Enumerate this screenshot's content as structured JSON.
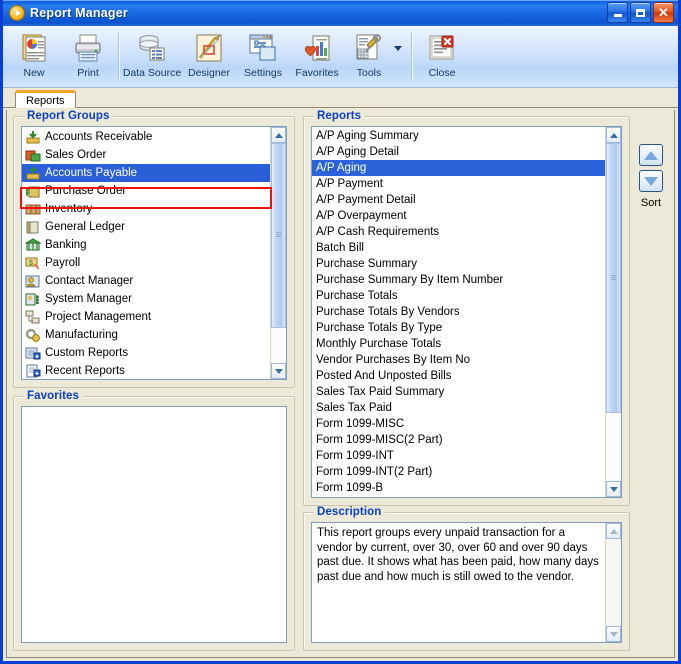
{
  "window": {
    "title": "Report Manager",
    "title_icon": "play-circle-icon",
    "minimize_label": "Minimize",
    "maximize_label": "Maximize",
    "close_label": "Close",
    "accent_titlebar": "#1c6fe8",
    "accent_group_title": "#0a3fbd",
    "selection_color": "#2a5fd8",
    "annotation_color": "#f01010",
    "background": "#ece9d8"
  },
  "toolbar": {
    "items": [
      {
        "label": "New",
        "icon": "new-report-icon"
      },
      {
        "label": "Print",
        "icon": "printer-icon"
      },
      {
        "label": "Data Source",
        "icon": "database-icon"
      },
      {
        "label": "Designer",
        "icon": "designer-pencil-icon"
      },
      {
        "label": "Settings",
        "icon": "settings-window-icon"
      },
      {
        "label": "Favorites",
        "icon": "favorites-heart-icon"
      },
      {
        "label": "Tools",
        "icon": "tools-wrench-icon"
      },
      {
        "label": "Close",
        "icon": "close-document-icon"
      }
    ]
  },
  "tabs": [
    {
      "label": "Reports",
      "active": true
    }
  ],
  "report_groups": {
    "title": "Report Groups",
    "selected": "Accounts Payable",
    "items": [
      {
        "label": "Accounts Receivable",
        "icon": "accounts-receivable-icon"
      },
      {
        "label": "Sales Order",
        "icon": "sales-order-icon"
      },
      {
        "label": "Accounts Payable",
        "icon": "accounts-payable-icon"
      },
      {
        "label": "Purchase Order",
        "icon": "purchase-order-icon"
      },
      {
        "label": "Inventory",
        "icon": "inventory-icon"
      },
      {
        "label": "General Ledger",
        "icon": "general-ledger-icon"
      },
      {
        "label": "Banking",
        "icon": "banking-icon"
      },
      {
        "label": "Payroll",
        "icon": "payroll-icon"
      },
      {
        "label": "Contact Manager",
        "icon": "contact-manager-icon"
      },
      {
        "label": "System Manager",
        "icon": "system-manager-icon"
      },
      {
        "label": "Project Management",
        "icon": "project-management-icon"
      },
      {
        "label": "Manufacturing",
        "icon": "manufacturing-icon"
      },
      {
        "label": "Custom Reports",
        "icon": "custom-reports-icon"
      },
      {
        "label": "Recent Reports",
        "icon": "recent-reports-icon"
      }
    ]
  },
  "favorites": {
    "title": "Favorites",
    "items": []
  },
  "reports": {
    "title": "Reports",
    "selected": "A/P Aging",
    "items": [
      "A/P Aging Summary",
      "A/P Aging Detail",
      "A/P Aging",
      "A/P Payment",
      "A/P Payment Detail",
      "A/P Overpayment",
      "A/P Cash Requirements",
      "Batch Bill",
      "Purchase Summary",
      "Purchase Summary By Item Number",
      "Purchase Totals",
      "Purchase Totals By Vendors",
      "Purchase Totals By Type",
      "Monthly Purchase Totals",
      "Vendor Purchases By Item No",
      "Posted And Unposted Bills",
      "Sales Tax Paid Summary",
      "Sales Tax Paid",
      "Form 1099-MISC",
      "Form 1099-MISC(2 Part)",
      "Form 1099-INT",
      "Form 1099-INT(2 Part)",
      "Form 1099-B"
    ]
  },
  "sort": {
    "label": "Sort",
    "up_label": "Sort ascending",
    "down_label": "Sort descending"
  },
  "description": {
    "title": "Description",
    "text": "This report groups every unpaid transaction for a vendor by current, over 30, over 60 and over 90 days past due. It shows what has been paid, how many days past due and how much is still owed to the vendor."
  }
}
